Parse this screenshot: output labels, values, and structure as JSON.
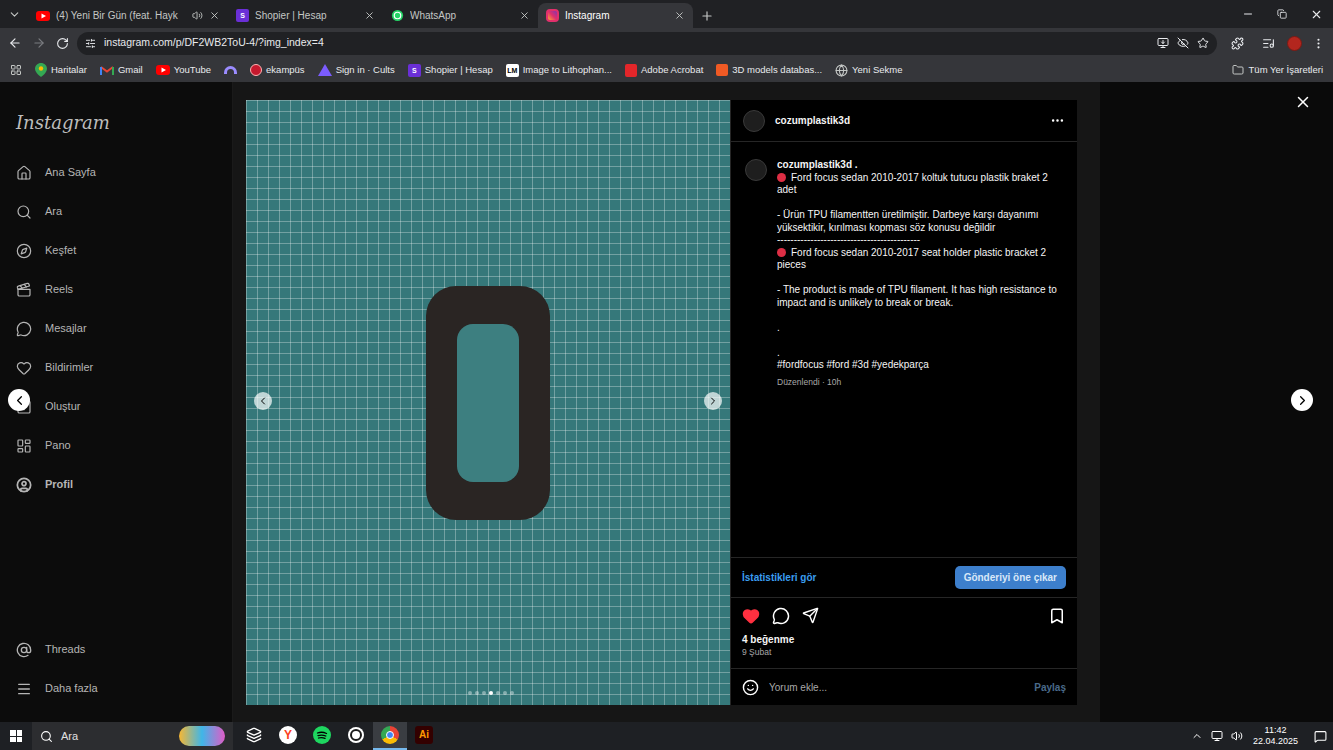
{
  "browser": {
    "tabs": [
      {
        "label": "(4) Yeni Bir Gün (feat. Hayk",
        "kind": "youtube",
        "glyph": "",
        "playing": true,
        "selected": false
      },
      {
        "label": "Shopier | Hesap",
        "kind": "shopier",
        "glyph": "S",
        "playing": false,
        "selected": false
      },
      {
        "label": "WhatsApp",
        "kind": "whatsapp",
        "glyph": "",
        "playing": false,
        "selected": false
      },
      {
        "label": "Instagram",
        "kind": "instagram",
        "glyph": "",
        "playing": false,
        "selected": true
      }
    ],
    "url": "instagram.com/p/DF2WB2ToU-4/?img_index=4",
    "bookmarks": [
      {
        "label": "Haritalar",
        "kind": "maps",
        "glyph": ""
      },
      {
        "label": "Gmail",
        "kind": "gmail",
        "glyph": ""
      },
      {
        "label": "YouTube",
        "kind": "youtube",
        "glyph": ""
      },
      {
        "label": "",
        "kind": "arc",
        "glyph": ""
      },
      {
        "label": "ekampüs",
        "kind": "ekampus",
        "glyph": ""
      },
      {
        "label": "Sign in · Cults",
        "kind": "cults",
        "glyph": ""
      },
      {
        "label": "Shopier | Hesap",
        "kind": "shopier",
        "glyph": "S"
      },
      {
        "label": "Image to Lithophan...",
        "kind": "lm",
        "glyph": "LM"
      },
      {
        "label": "Adobe Acrobat",
        "kind": "acrobat",
        "glyph": ""
      },
      {
        "label": "3D models databas...",
        "kind": "models3d",
        "glyph": ""
      },
      {
        "label": "Yeni Sekme",
        "kind": "globe",
        "glyph": ""
      }
    ],
    "all_bookmarks": "Tüm Yer İşaretleri"
  },
  "sidebar": {
    "logo": "Instagram",
    "items": [
      {
        "label": "Ana Sayfa",
        "kind": "home",
        "selected": false
      },
      {
        "label": "Ara",
        "kind": "search",
        "selected": false
      },
      {
        "label": "Keşfet",
        "kind": "explore",
        "selected": false
      },
      {
        "label": "Reels",
        "kind": "reels",
        "selected": false
      },
      {
        "label": "Mesajlar",
        "kind": "messages",
        "selected": false
      },
      {
        "label": "Bildirimler",
        "kind": "notifications",
        "selected": false
      },
      {
        "label": "Oluştur",
        "kind": "create",
        "selected": false
      },
      {
        "label": "Pano",
        "kind": "dashboard",
        "selected": false
      },
      {
        "label": "Profil",
        "kind": "profile",
        "selected": true
      }
    ],
    "bottom": [
      {
        "label": "Threads",
        "kind": "threads"
      },
      {
        "label": "Daha fazla",
        "kind": "more"
      }
    ]
  },
  "post": {
    "username": "cozumplastik3d",
    "caption_author": "cozumplastik3d .",
    "caption": [
      {
        "kind": "bullet",
        "text": "Ford focus sedan 2010-2017 koltuk tutucu plastik braket 2 adet"
      },
      {
        "kind": "blank",
        "text": ""
      },
      {
        "kind": "plain",
        "text": "- Ürün TPU filamentten üretilmiştir. Darbeye karşı dayanımı yüksektikir, kırılması kopması söz konusu değildir"
      },
      {
        "kind": "plain",
        "text": "-------------------------------------------"
      },
      {
        "kind": "bullet",
        "text": "Ford focus sedan 2010-2017 seat holder plastic bracket 2 pieces"
      },
      {
        "kind": "blank",
        "text": ""
      },
      {
        "kind": "plain",
        "text": "- The product is made of TPU filament. It has high resistance to impact and is unlikely to break or break."
      },
      {
        "kind": "blank",
        "text": ""
      },
      {
        "kind": "plain",
        "text": "."
      },
      {
        "kind": "blank",
        "text": ""
      },
      {
        "kind": "plain",
        "text": "."
      },
      {
        "kind": "plain",
        "text": "#fordfocus #ford #3d #yedekparça"
      }
    ],
    "edited": "Düzenlendi · 10h",
    "stats_link": "İstatistikleri gör",
    "boost_button": "Gönderiyi öne çıkar",
    "liked": true,
    "saved": false,
    "likes": "4 beğenme",
    "date": "9 Şubat",
    "comment_placeholder": "Yorum ekle...",
    "comment_submit": "Paylaş",
    "carousel": [
      {
        "selected": false
      },
      {
        "selected": false
      },
      {
        "selected": false
      },
      {
        "selected": true
      },
      {
        "selected": false
      },
      {
        "selected": false
      },
      {
        "selected": false
      }
    ]
  },
  "taskbar": {
    "search": "Ara",
    "apps": [
      {
        "kind": "taskview",
        "glyph": "",
        "selected": false
      },
      {
        "kind": "yandex",
        "glyph": "Y",
        "selected": false
      },
      {
        "kind": "spotify",
        "glyph": "",
        "selected": false
      },
      {
        "kind": "app",
        "glyph": "",
        "selected": false
      },
      {
        "kind": "chrome",
        "glyph": "",
        "selected": true
      },
      {
        "kind": "illustrator",
        "glyph": "Ai",
        "selected": false
      }
    ],
    "time": "11:42",
    "date": "22.04.2025"
  }
}
